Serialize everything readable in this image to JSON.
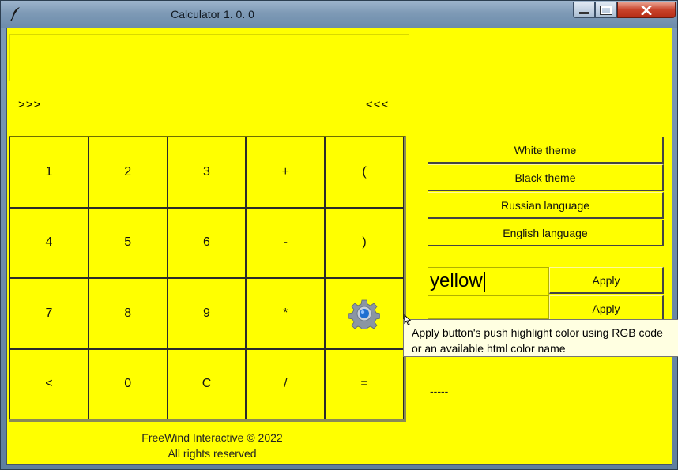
{
  "window": {
    "title": "Calculator 1. 0. 0",
    "icon": "feather-icon",
    "controls": {
      "minimize": "minimize-icon",
      "maximize": "maximize-icon",
      "close": "close-icon"
    }
  },
  "display": {
    "value": ""
  },
  "nav": {
    "left": ">>>",
    "right": "<<<"
  },
  "keypad": {
    "rows": [
      [
        "1",
        "2",
        "3",
        "+",
        "("
      ],
      [
        "4",
        "5",
        "6",
        "-",
        ")"
      ],
      [
        "7",
        "8",
        "9",
        "*",
        ""
      ],
      [
        "<",
        "0",
        "C",
        "/",
        "="
      ]
    ],
    "settings_icon": "gear-icon"
  },
  "footer": {
    "line1": "FreeWind Interactive © 2022",
    "line2": "All rights reserved"
  },
  "side_buttons": [
    "White theme",
    "Black theme",
    "Russian language",
    "English language"
  ],
  "color_inputs": [
    {
      "value": "yellow",
      "apply_label": "Apply"
    },
    {
      "value": "",
      "apply_label": "Apply"
    }
  ],
  "status_text": "-----",
  "tooltip": {
    "line1": "Apply button's push highlight color using RGB code",
    "line2": "or an available html color name"
  },
  "colors": {
    "background": "#ffff00",
    "tooltip": "#ffffe1"
  }
}
